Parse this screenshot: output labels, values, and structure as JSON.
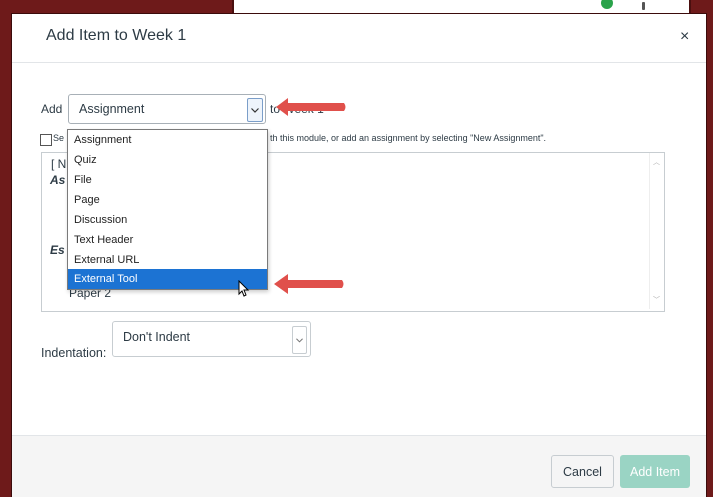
{
  "colors": {
    "backdrop": "#6e1a1a",
    "selected": "#1c73d3",
    "primary_disabled": "#9ad4c4",
    "arrow": "#e0504b"
  },
  "dialog": {
    "title": "Add Item to Week 1",
    "close_label": "×"
  },
  "form": {
    "add_label": "Add",
    "type_value": "Assignment",
    "to_label": "to Week 1",
    "hint_left": "Se",
    "hint_right": "th this module, or add an assignment by selecting \"New Assignment\".",
    "type_options": [
      "Assignment",
      "Quiz",
      "File",
      "Page",
      "Discussion",
      "Text Header",
      "External URL",
      "External Tool"
    ],
    "type_selected": "External Tool"
  },
  "listbox": {
    "items": [
      "[ N",
      "As",
      "Es",
      "Paper 2"
    ]
  },
  "indentation": {
    "label": "Indentation:",
    "value": "Don't Indent"
  },
  "footer": {
    "cancel_label": "Cancel",
    "add_label": "Add Item"
  }
}
